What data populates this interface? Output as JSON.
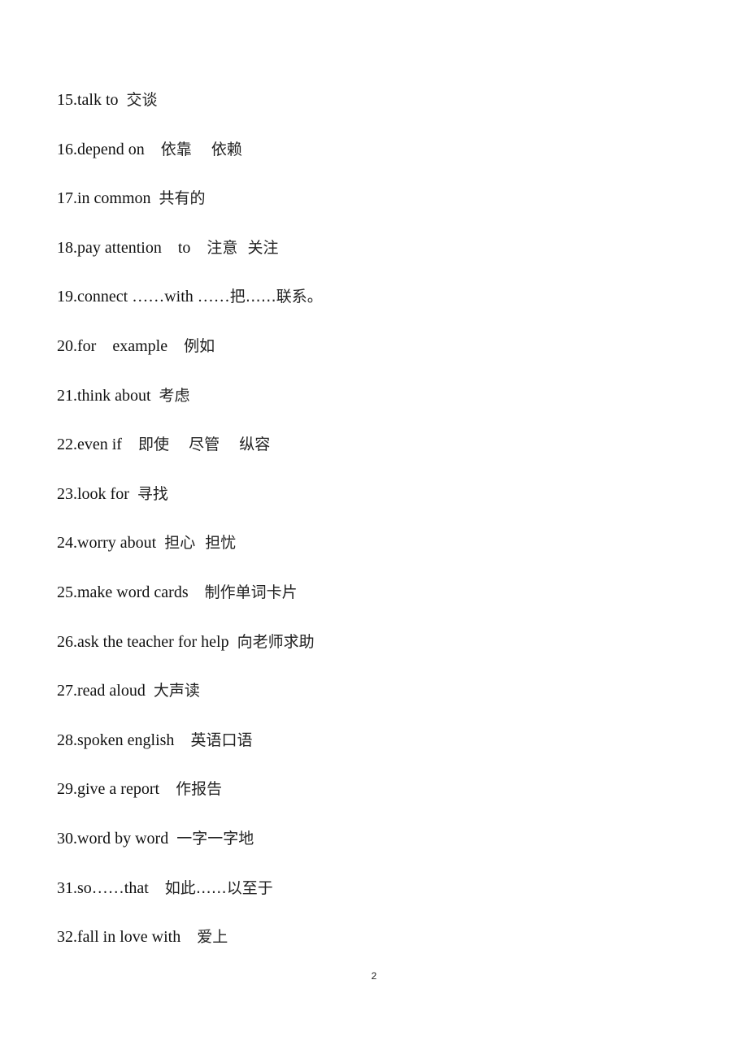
{
  "document": {
    "entries": [
      {
        "en": "15.talk to  ",
        "zh": "交谈"
      },
      {
        "en": "16.depend on    ",
        "zh": "依靠    依赖"
      },
      {
        "en": "17.in common  ",
        "zh": "共有的"
      },
      {
        "en": "18.pay attention    to    ",
        "zh": "注意  关注"
      },
      {
        "en": "19.connect ……with ……",
        "zh": "把……联系。"
      },
      {
        "en": "20.for    example    ",
        "zh": "例如"
      },
      {
        "en": "21.think about  ",
        "zh": "考虑"
      },
      {
        "en": "22.even if    ",
        "zh": "即使    尽管    纵容"
      },
      {
        "en": "23.look for  ",
        "zh": "寻找"
      },
      {
        "en": "24.worry about  ",
        "zh": "担心  担忧"
      },
      {
        "en": "25.make word cards    ",
        "zh": "制作单词卡片"
      },
      {
        "en": "26.ask the teacher for help  ",
        "zh": "向老师求助"
      },
      {
        "en": "27.read aloud  ",
        "zh": "大声读"
      },
      {
        "en": "28.spoken english    ",
        "zh": "英语口语"
      },
      {
        "en": "29.give a report    ",
        "zh": "作报告"
      },
      {
        "en": "30.word by word  ",
        "zh": "一字一字地"
      },
      {
        "en": "31.so……that    ",
        "zh": "如此……以至于"
      },
      {
        "en": "32.fall in love with    ",
        "zh": "爱上"
      }
    ],
    "page_number": "2"
  }
}
